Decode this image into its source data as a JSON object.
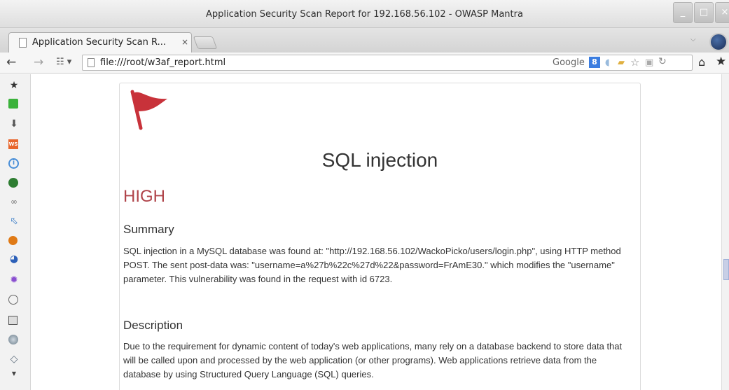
{
  "window": {
    "title": "Application Security Scan Report for 192.168.56.102 - OWASP Mantra",
    "minimize": "_",
    "maximize": "□",
    "close": "×"
  },
  "tabs": [
    {
      "label": "Application Security Scan R...",
      "close": "×"
    }
  ],
  "navbar": {
    "back": "←",
    "forward": "→",
    "apps": "☷ ▾",
    "url": "file:///root/w3af_report.html",
    "search_engine": "Google",
    "search_engine_badge": "8",
    "home": "⌂",
    "bookmarks": "★"
  },
  "sidebar": {
    "icons": [
      "star-icon",
      "puzzle-icon",
      "download-icon",
      "ws-icon",
      "info-icon",
      "shield-icon",
      "link-icon",
      "cursor-icon",
      "bug-icon",
      "swirl-icon",
      "gear-icon",
      "cookie-icon",
      "grid-icon",
      "globe-icon",
      "diamond-icon"
    ]
  },
  "report": {
    "title": "SQL injection",
    "severity": "HIGH",
    "severity_color": "#b0444a",
    "flag_color": "#c8323a",
    "summary_heading": "Summary",
    "summary_text": "SQL injection in a MySQL database was found at: \"http://192.168.56.102/WackoPicko/users/login.php\", using HTTP method POST. The sent post-data was: \"username=a%27b%22c%27d%22&password=FrAmE30.\" which modifies the \"username\" parameter. This vulnerability was found in the request with id 6723.",
    "description_heading": "Description",
    "description_text": "Due to the requirement for dynamic content of today's web applications, many rely on a database backend to store data that will be called upon and processed by the web application (or other programs). Web applications retrieve data from the database by using Structured Query Language (SQL) queries."
  }
}
